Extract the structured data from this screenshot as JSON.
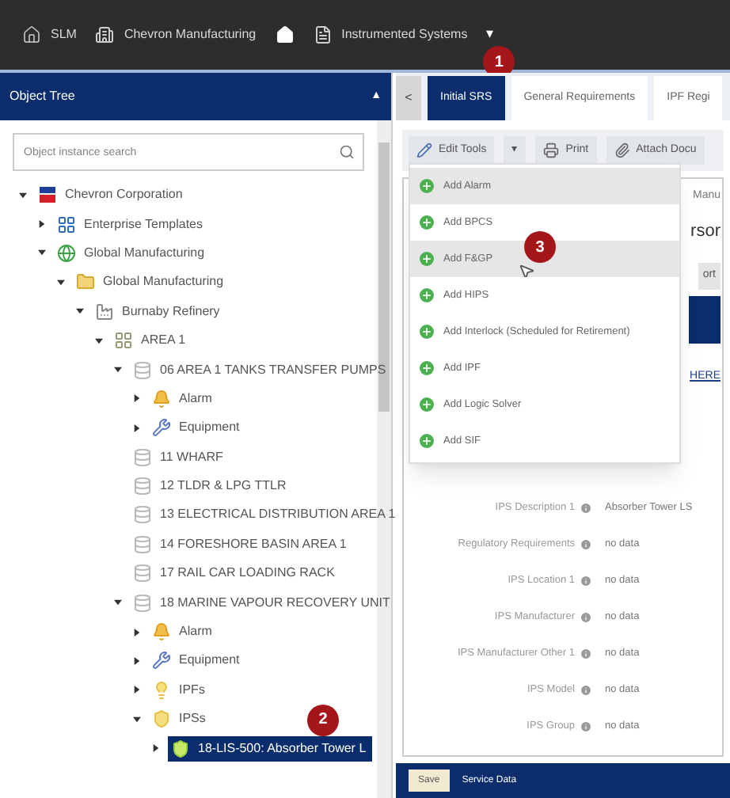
{
  "top_bar": {
    "items": [
      {
        "kind": "home-outline",
        "label": "SLM"
      },
      {
        "kind": "building",
        "label": "Chevron Manufacturing"
      },
      {
        "kind": "home"
      },
      {
        "kind": "document",
        "label": "Instrumented Systems"
      }
    ],
    "caret": "▾",
    "badge": "1"
  },
  "object_tree": {
    "title": "Object Tree",
    "collapse": "▲",
    "search": {
      "placeholder": "Object instance search"
    },
    "nodes": [
      {
        "kind": "company",
        "label": "Chevron Corporation",
        "expanded": true,
        "selected": false,
        "children": [
          {
            "kind": "template",
            "label": "Enterprise Templates",
            "expanded": false,
            "selected": false
          },
          {
            "kind": "globe",
            "label": "Global Manufacturing",
            "expanded": true,
            "selected": false,
            "children": [
              {
                "kind": "folder",
                "label": "Global Manufacturing",
                "expanded": true,
                "selected": false,
                "children": [
                  {
                    "kind": "refinery",
                    "label": "Burnaby Refinery",
                    "expanded": true,
                    "selected": false,
                    "children": [
                      {
                        "kind": "area",
                        "label": "AREA 1",
                        "expanded": true,
                        "selected": false,
                        "children": [
                          {
                            "kind": "unit",
                            "label": "06 AREA 1 TANKS TRANSFER PUMPS",
                            "expanded": true,
                            "selected": false,
                            "children": [
                              {
                                "kind": "alarm",
                                "label": "Alarm",
                                "expanded": false,
                                "selected": false
                              },
                              {
                                "kind": "equipment",
                                "label": "Equipment",
                                "expanded": false,
                                "selected": false
                              }
                            ]
                          },
                          {
                            "kind": "unit",
                            "label": "11 WHARF",
                            "selected": false
                          },
                          {
                            "kind": "unit",
                            "label": "12 TLDR & LPG TTLR",
                            "selected": false
                          },
                          {
                            "kind": "unit",
                            "label": "13 ELECTRICAL DISTRIBUTION AREA 1",
                            "selected": false
                          },
                          {
                            "kind": "unit",
                            "label": "14 FORESHORE BASIN AREA 1",
                            "selected": false
                          },
                          {
                            "kind": "unit",
                            "label": "17 RAIL CAR LOADING RACK",
                            "selected": false
                          },
                          {
                            "kind": "unit",
                            "label": "18 MARINE VAPOUR RECOVERY UNIT",
                            "expanded": true,
                            "selected": false,
                            "children": [
                              {
                                "kind": "alarm",
                                "label": "Alarm",
                                "expanded": false,
                                "selected": false
                              },
                              {
                                "kind": "equipment",
                                "label": "Equipment",
                                "expanded": false,
                                "selected": false
                              },
                              {
                                "kind": "ipf",
                                "label": "IPFs",
                                "expanded": false,
                                "selected": false
                              },
                              {
                                "kind": "ips",
                                "label": "IPSs",
                                "expanded": true,
                                "selected": false,
                                "children": [
                                  {
                                    "kind": "ips-item",
                                    "label": "18-LIS-500: Absorber Tower L",
                                    "expanded": false,
                                    "selected": true,
                                    "badge": "2"
                                  }
                                ]
                              }
                            ]
                          }
                        ]
                      }
                    ]
                  }
                ]
              }
            ]
          }
        ]
      }
    ]
  },
  "tabs": {
    "back": "<",
    "items": [
      {
        "label": "Initial SRS",
        "selected": true
      },
      {
        "label": "General Requirements",
        "selected": false
      },
      {
        "label": "IPF Regi",
        "selected": false
      }
    ]
  },
  "toolbar": {
    "buttons": [
      {
        "kind": "edit",
        "label": "Edit Tools"
      },
      {
        "kind": "caret",
        "label": "▾"
      },
      {
        "kind": "print",
        "label": "Print"
      },
      {
        "kind": "attach",
        "label": "Attach Docu"
      }
    ]
  },
  "menu": {
    "items": [
      {
        "label": "Add Alarm",
        "highlighted": true
      },
      {
        "label": "Add BPCS",
        "highlighted": false
      },
      {
        "label": "Add F&GP",
        "highlighted": true,
        "badge": "3"
      },
      {
        "label": "Add HIPS",
        "highlighted": false
      },
      {
        "label": "Add Interlock (Scheduled for Retirement)",
        "highlighted": false
      },
      {
        "label": "Add IPF",
        "highlighted": false
      },
      {
        "label": "Add Logic Solver",
        "highlighted": false
      },
      {
        "label": "Add SIF",
        "highlighted": false
      }
    ]
  },
  "behind_menu": {
    "subtitle": "Manu",
    "heading": "rsor",
    "button": "ort",
    "link": "HERE"
  },
  "fields": [
    {
      "label": "IPS Description 1",
      "value": "Absorber Tower LS"
    },
    {
      "label": "Regulatory Requirements",
      "value": "no data"
    },
    {
      "label": "IPS Location 1",
      "value": "no data"
    },
    {
      "label": "IPS Manufacturer",
      "value": "no data"
    },
    {
      "label": "IPS Manufacturer Other 1",
      "value": "no data"
    },
    {
      "label": "IPS Model",
      "value": "no data"
    },
    {
      "label": "IPS Group",
      "value": "no data"
    }
  ],
  "footer": {
    "button": "Save",
    "title": "Service Data"
  }
}
